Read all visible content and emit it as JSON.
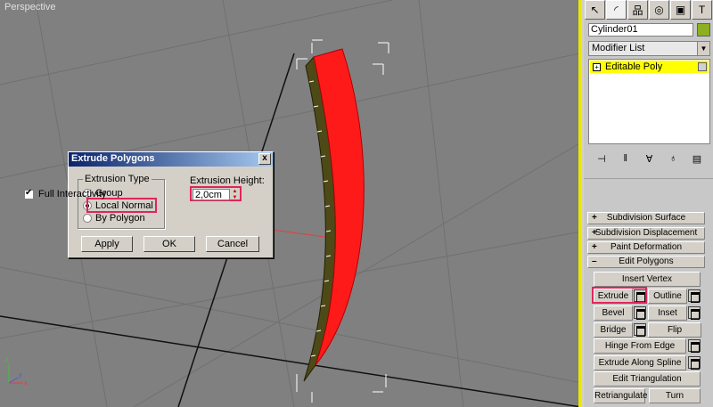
{
  "viewport": {
    "label": "Perspective"
  },
  "dialog": {
    "title": "Extrude Polygons",
    "close_label": "x",
    "extrusion_type_label": "Extrusion Type",
    "options": [
      "Group",
      "Local Normal",
      "By Polygon"
    ],
    "selected_option": "Local Normal",
    "height_label": "Extrusion Height:",
    "height_value": "2,0cm",
    "buttons": {
      "apply": "Apply",
      "ok": "OK",
      "cancel": "Cancel"
    }
  },
  "panel": {
    "object_name": "Cylinder01",
    "object_color": "#8cb020",
    "modifier_list_label": "Modifier List",
    "stack_item": "Editable Poly",
    "full_interactivity": "Full Interactivity",
    "rollouts": {
      "subdivision_surface": "Subdivision Surface",
      "subdivision_displacement": "Subdivision Displacement",
      "paint_deformation": "Paint Deformation",
      "edit_polygons": "Edit Polygons"
    },
    "buttons": {
      "insert_vertex": "Insert Vertex",
      "extrude": "Extrude",
      "outline": "Outline",
      "bevel": "Bevel",
      "inset": "Inset",
      "bridge": "Bridge",
      "flip": "Flip",
      "hinge_from_edge": "Hinge From Edge",
      "extrude_along_spline": "Extrude Along Spline",
      "edit_triangulation": "Edit Triangulation",
      "retriangulate": "Retriangulate",
      "turn": "Turn"
    }
  },
  "colors": {
    "highlight": "#e0245a",
    "object": "#ff0000",
    "active_stack": "#ffff00",
    "viewport_border": "#e8e800"
  }
}
